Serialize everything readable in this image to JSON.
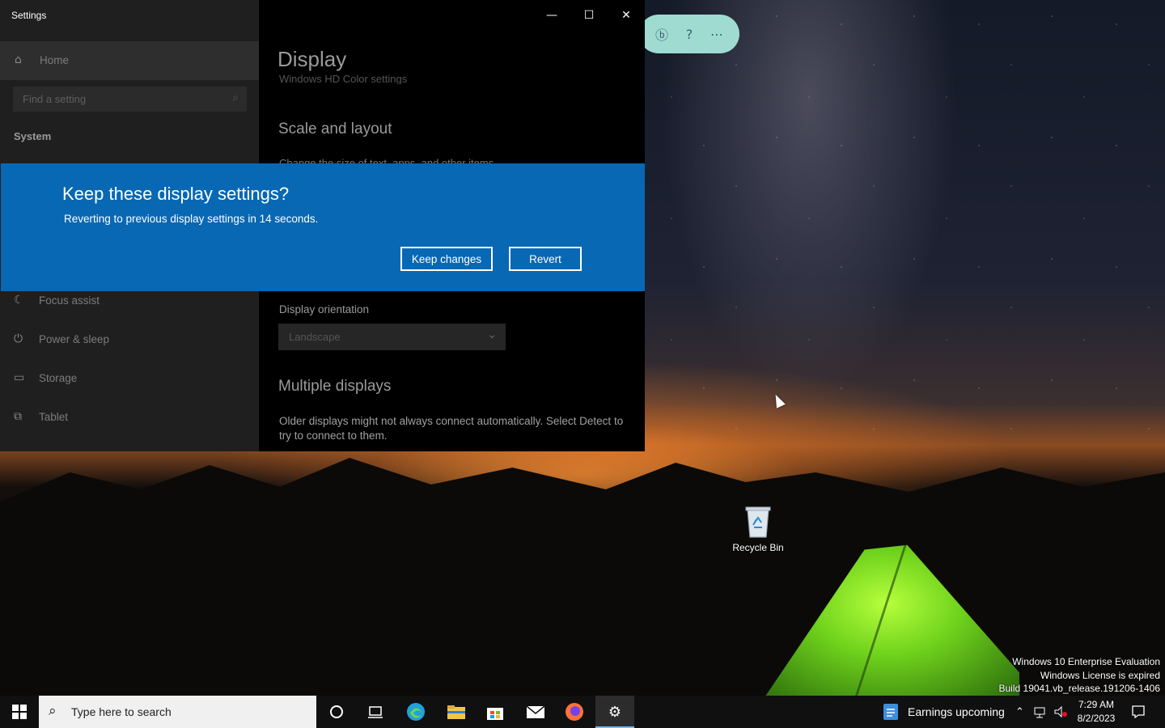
{
  "settings": {
    "window_title": "Settings",
    "minimize": "—",
    "maximize": "☐",
    "close": "✕",
    "sidebar": {
      "home_label": "Home",
      "search_placeholder": "Find a setting",
      "section": "System",
      "items": [
        {
          "label": "Focus assist",
          "icon": "moon-icon"
        },
        {
          "label": "Power & sleep",
          "icon": "power-icon"
        },
        {
          "label": "Storage",
          "icon": "storage-icon"
        },
        {
          "label": "Tablet",
          "icon": "tablet-icon"
        }
      ]
    },
    "content": {
      "title": "Display",
      "ghost_hdr": "Windows HD Color settings",
      "scale_heading": "Scale and layout",
      "scale_sub": "Change the size of text, apps, and other items",
      "orientation_label": "Display orientation",
      "orientation_value": "Landscape",
      "multiple_heading": "Multiple displays",
      "multiple_desc": "Older displays might not always connect automatically. Select Detect to try to connect to them."
    }
  },
  "dialog": {
    "title": "Keep these display settings?",
    "message": "Reverting to previous display settings in 14 seconds.",
    "keep_label": "Keep changes",
    "revert_label": "Revert",
    "color": "#0868b4"
  },
  "desktop": {
    "recycle_bin_label": "Recycle Bin",
    "watermark": [
      "Windows 10 Enterprise Evaluation",
      "Windows License is expired",
      "Build 19041.vb_release.191206-1406"
    ]
  },
  "pill_toolbar": [
    "bing-icon",
    "help-icon",
    "more-icon"
  ],
  "taskbar": {
    "search_placeholder": "Type here to search",
    "news_label": "Earnings upcoming",
    "time": "7:29 AM",
    "date": "8/2/2023",
    "apps": [
      "cortana-icon",
      "task-view-icon",
      "edge-icon",
      "file-explorer-icon",
      "store-icon",
      "mail-icon",
      "firefox-icon",
      "settings-icon"
    ]
  }
}
